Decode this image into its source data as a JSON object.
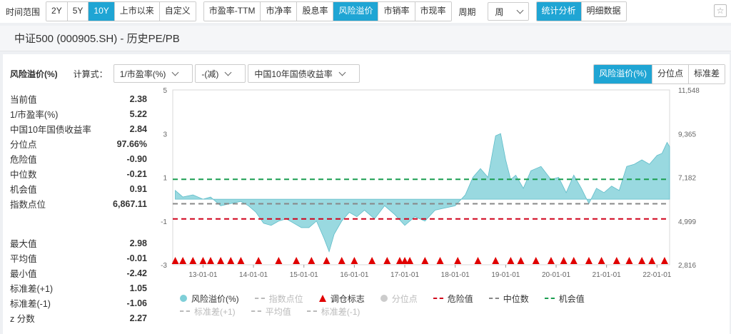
{
  "toolbar": {
    "range_label": "时间范围",
    "ranges": [
      "2Y",
      "5Y",
      "10Y",
      "上市以来",
      "自定义"
    ],
    "metrics": [
      "市盈率-TTM",
      "市净率",
      "股息率",
      "风险溢价",
      "市销率",
      "市现率"
    ],
    "period_label": "周期",
    "period_value": "周",
    "views": [
      "统计分析",
      "明细数据"
    ],
    "star_glyph": "☆",
    "accent_color": "#1fa5d4"
  },
  "title": "中证500 (000905.SH) - 历史PE/PB",
  "controls": {
    "panel_title": "风险溢价(%)",
    "formula_label": "计算式：",
    "formula_parts": [
      "1/市盈率(%)",
      "-(减)",
      "中国10年国债收益率"
    ],
    "tabs": [
      "风险溢价(%)",
      "分位点",
      "标准差"
    ]
  },
  "stats_current": [
    {
      "label": "当前值",
      "value": "2.38"
    },
    {
      "label": "1/市盈率(%)",
      "value": "5.22"
    },
    {
      "label": "中国10年国债收益率",
      "value": "2.84"
    },
    {
      "label": "分位点",
      "value": "97.66%"
    },
    {
      "label": "危险值",
      "value": "-0.90"
    },
    {
      "label": "中位数",
      "value": "-0.21"
    },
    {
      "label": "机会值",
      "value": "0.91"
    },
    {
      "label": "指数点位",
      "value": "6,867.11"
    }
  ],
  "stats_summary": [
    {
      "label": "最大值",
      "value": "2.98"
    },
    {
      "label": "平均值",
      "value": "-0.01"
    },
    {
      "label": "最小值",
      "value": "-2.42"
    },
    {
      "label": "标准差(+1)",
      "value": "1.05"
    },
    {
      "label": "标准差(-1)",
      "value": "-1.06"
    },
    {
      "label": "z 分数",
      "value": "2.27"
    }
  ],
  "chart_data": {
    "type": "area",
    "title": "",
    "x_ticks": [
      "13-01-01",
      "14-01-01",
      "15-01-01",
      "16-01-01",
      "17-01-01",
      "18-01-01",
      "19-01-01",
      "20-01-01",
      "21-01-01",
      "22-01-01"
    ],
    "y_left_ticks": [
      5,
      3,
      1,
      -1,
      -3
    ],
    "y_left_range": [
      -3,
      5
    ],
    "y_right_ticks": [
      "11,548",
      "9,365",
      "7,182",
      "4,999",
      "2,816"
    ],
    "series": [
      {
        "name": "风险溢价(%)",
        "color": "#7fcfd8",
        "x": [
          2012.45,
          2012.6,
          2012.8,
          2013.0,
          2013.15,
          2013.35,
          2013.55,
          2013.75,
          2013.9,
          2014.05,
          2014.2,
          2014.35,
          2014.5,
          2014.65,
          2014.8,
          2014.95,
          2015.1,
          2015.25,
          2015.4,
          2015.5,
          2015.6,
          2015.75,
          2015.9,
          2016.05,
          2016.2,
          2016.4,
          2016.6,
          2016.8,
          2017.0,
          2017.2,
          2017.4,
          2017.6,
          2017.8,
          2018.0,
          2018.2,
          2018.35,
          2018.5,
          2018.65,
          2018.8,
          2018.9,
          2019.0,
          2019.1,
          2019.2,
          2019.35,
          2019.5,
          2019.7,
          2019.9,
          2020.05,
          2020.2,
          2020.35,
          2020.5,
          2020.65,
          2020.8,
          2020.95,
          2021.1,
          2021.25,
          2021.4,
          2021.55,
          2021.7,
          2021.85,
          2022.0,
          2022.1,
          2022.2,
          2022.25
        ],
        "values": [
          0.4,
          0.1,
          0.2,
          0.0,
          0.1,
          -0.3,
          -0.2,
          -0.1,
          -0.3,
          -0.6,
          -1.1,
          -1.2,
          -1.0,
          -0.9,
          -1.1,
          -1.3,
          -1.3,
          -1.0,
          -1.8,
          -2.4,
          -1.6,
          -1.0,
          -0.6,
          -0.8,
          -0.5,
          -0.9,
          -0.3,
          -0.7,
          -1.2,
          -0.8,
          -1.0,
          -0.5,
          -0.4,
          -0.3,
          0.2,
          1.0,
          1.4,
          1.0,
          2.9,
          3.0,
          1.8,
          0.9,
          1.1,
          0.5,
          1.3,
          1.5,
          0.9,
          1.0,
          0.3,
          1.1,
          0.5,
          -0.2,
          0.5,
          0.3,
          0.6,
          0.4,
          1.5,
          1.6,
          1.8,
          1.6,
          2.0,
          2.1,
          2.6,
          2.4
        ]
      }
    ],
    "reference_lines": [
      {
        "name": "危险值",
        "value": -0.9,
        "color": "#d0021b"
      },
      {
        "name": "中位数",
        "value": -0.21,
        "color": "#888888"
      },
      {
        "name": "机会值",
        "value": 0.91,
        "color": "#1a9e50"
      }
    ],
    "rebalance_markers": [
      2012.45,
      2012.6,
      2012.8,
      2013.0,
      2013.15,
      2013.35,
      2013.55,
      2013.75,
      2014.1,
      2014.5,
      2014.85,
      2015.15,
      2015.45,
      2015.75,
      2016.0,
      2016.35,
      2016.65,
      2016.9,
      2017.0,
      2017.1,
      2017.4,
      2017.7,
      2018.05,
      2018.45,
      2018.8,
      2019.1,
      2019.3,
      2019.6,
      2019.9,
      2020.15,
      2020.35,
      2020.65,
      2020.9,
      2021.2,
      2021.45,
      2021.7,
      2021.9,
      2022.15
    ],
    "legend": [
      {
        "name": "风险溢价(%)",
        "symbol": "dot",
        "color": "#7fcfd8",
        "active": true
      },
      {
        "name": "指数点位",
        "symbol": "dash",
        "color": "#bbbbbb",
        "active": false
      },
      {
        "name": "调仓标志",
        "symbol": "triangle",
        "color": "#e00000",
        "active": true
      },
      {
        "name": "分位点",
        "symbol": "dot",
        "color": "#cccccc",
        "active": false
      },
      {
        "name": "危险值",
        "symbol": "dash",
        "color": "#d0021b",
        "active": true
      },
      {
        "name": "中位数",
        "symbol": "dash",
        "color": "#888888",
        "active": true
      },
      {
        "name": "机会值",
        "symbol": "dash",
        "color": "#1a9e50",
        "active": true
      },
      {
        "name": "标准差(+1)",
        "symbol": "dash",
        "color": "#bbbbbb",
        "active": false
      },
      {
        "name": "平均值",
        "symbol": "dash",
        "color": "#bbbbbb",
        "active": false
      },
      {
        "name": "标准差(-1)",
        "symbol": "dash",
        "color": "#bbbbbb",
        "active": false
      }
    ]
  }
}
